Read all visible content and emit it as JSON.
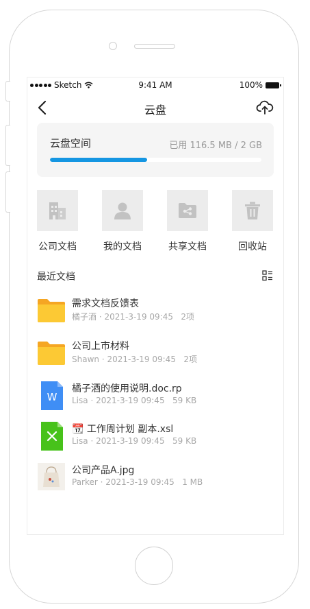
{
  "status_bar": {
    "carrier": "Sketch",
    "time": "9:41 AM",
    "battery": "100%"
  },
  "nav": {
    "title": "云盘"
  },
  "storage": {
    "title": "云盘空间",
    "used_text": "已用 116.5 MB / 2 GB",
    "progress": 0.46,
    "accent": "#1596e2"
  },
  "categories": [
    {
      "label": "公司文档",
      "icon": "building-icon"
    },
    {
      "label": "我的文档",
      "icon": "user-icon"
    },
    {
      "label": "共享文档",
      "icon": "shared-folder-icon"
    },
    {
      "label": "回收站",
      "icon": "trash-icon"
    }
  ],
  "recent": {
    "title": "最近文档",
    "files": [
      {
        "name": "需求文档反馈表",
        "owner": "橘子酒",
        "date": "2021-3-19 09:45",
        "size": "2项",
        "icon": "folder-icon"
      },
      {
        "name": "公司上市材料",
        "owner": "Shawn",
        "date": "2021-3-19 09:45",
        "size": "2项",
        "icon": "folder-icon"
      },
      {
        "name": "橘子酒的使用说明.doc.rp",
        "owner": "Lisa",
        "date": "2021-3-19 09:45",
        "size": "59 KB",
        "icon": "word-doc-icon"
      },
      {
        "name": "📆 工作周计划 副本.xsl",
        "owner": "Lisa",
        "date": "2021-3-19 09:45",
        "size": "59 KB",
        "icon": "excel-sheet-icon"
      },
      {
        "name": "公司产品A.jpg",
        "owner": "Parker",
        "date": "2021-3-19 09:45",
        "size": "1 MB",
        "icon": "image-thumbnail-icon"
      }
    ]
  }
}
